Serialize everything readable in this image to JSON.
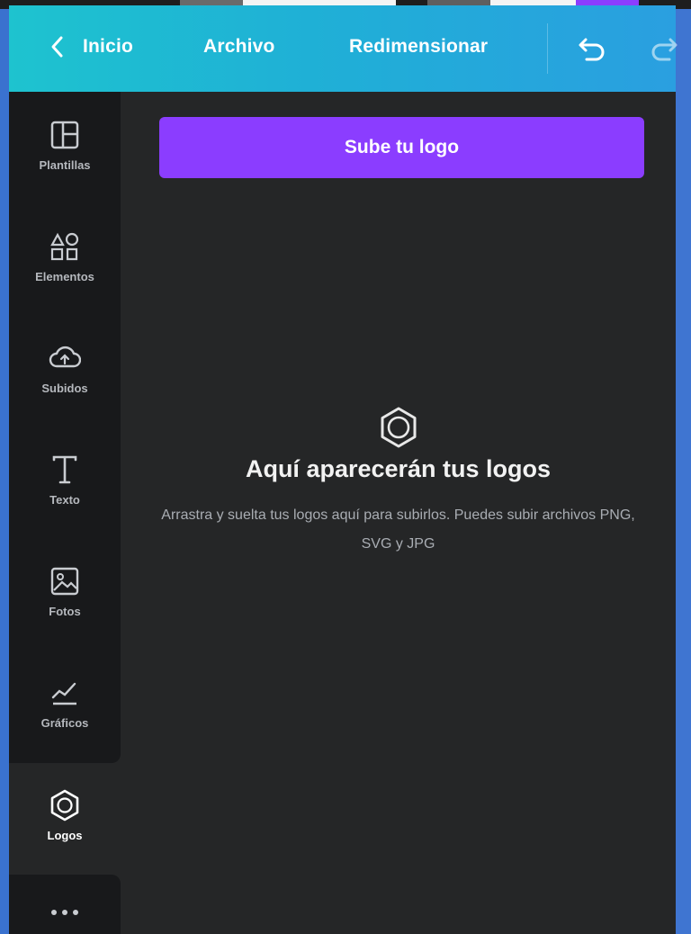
{
  "header": {
    "back_label": "Inicio",
    "file_label": "Archivo",
    "resize_label": "Redimensionar"
  },
  "sidebar": {
    "items": [
      {
        "id": "plantillas",
        "label": "Plantillas",
        "icon": "templates-icon",
        "active": false
      },
      {
        "id": "elementos",
        "label": "Elementos",
        "icon": "elements-icon",
        "active": false
      },
      {
        "id": "subidos",
        "label": "Subidos",
        "icon": "upload-cloud-icon",
        "active": false
      },
      {
        "id": "texto",
        "label": "Texto",
        "icon": "text-icon",
        "active": false
      },
      {
        "id": "fotos",
        "label": "Fotos",
        "icon": "photos-icon",
        "active": false
      },
      {
        "id": "graficos",
        "label": "Gráficos",
        "icon": "graphics-icon",
        "active": false
      },
      {
        "id": "logos",
        "label": "Logos",
        "icon": "logos-hexagon-icon",
        "active": true
      }
    ],
    "more": {
      "label": "",
      "icon": "more-dots-icon"
    }
  },
  "logos_panel": {
    "upload_button_label": "Sube tu logo",
    "empty_icon": "logos-hexagon-icon",
    "empty_title": "Aquí aparecerán tus logos",
    "empty_description": "Arrastra y suelta tus logos aquí para subirlos. Puedes subir archivos PNG, SVG y JPG"
  },
  "colors": {
    "header_gradient_start": "#1ec3cf",
    "header_gradient_end": "#2a9fe0",
    "panel_bg": "#252627",
    "sidebar_bg": "#18191b",
    "accent_button": "#8b3dff"
  }
}
